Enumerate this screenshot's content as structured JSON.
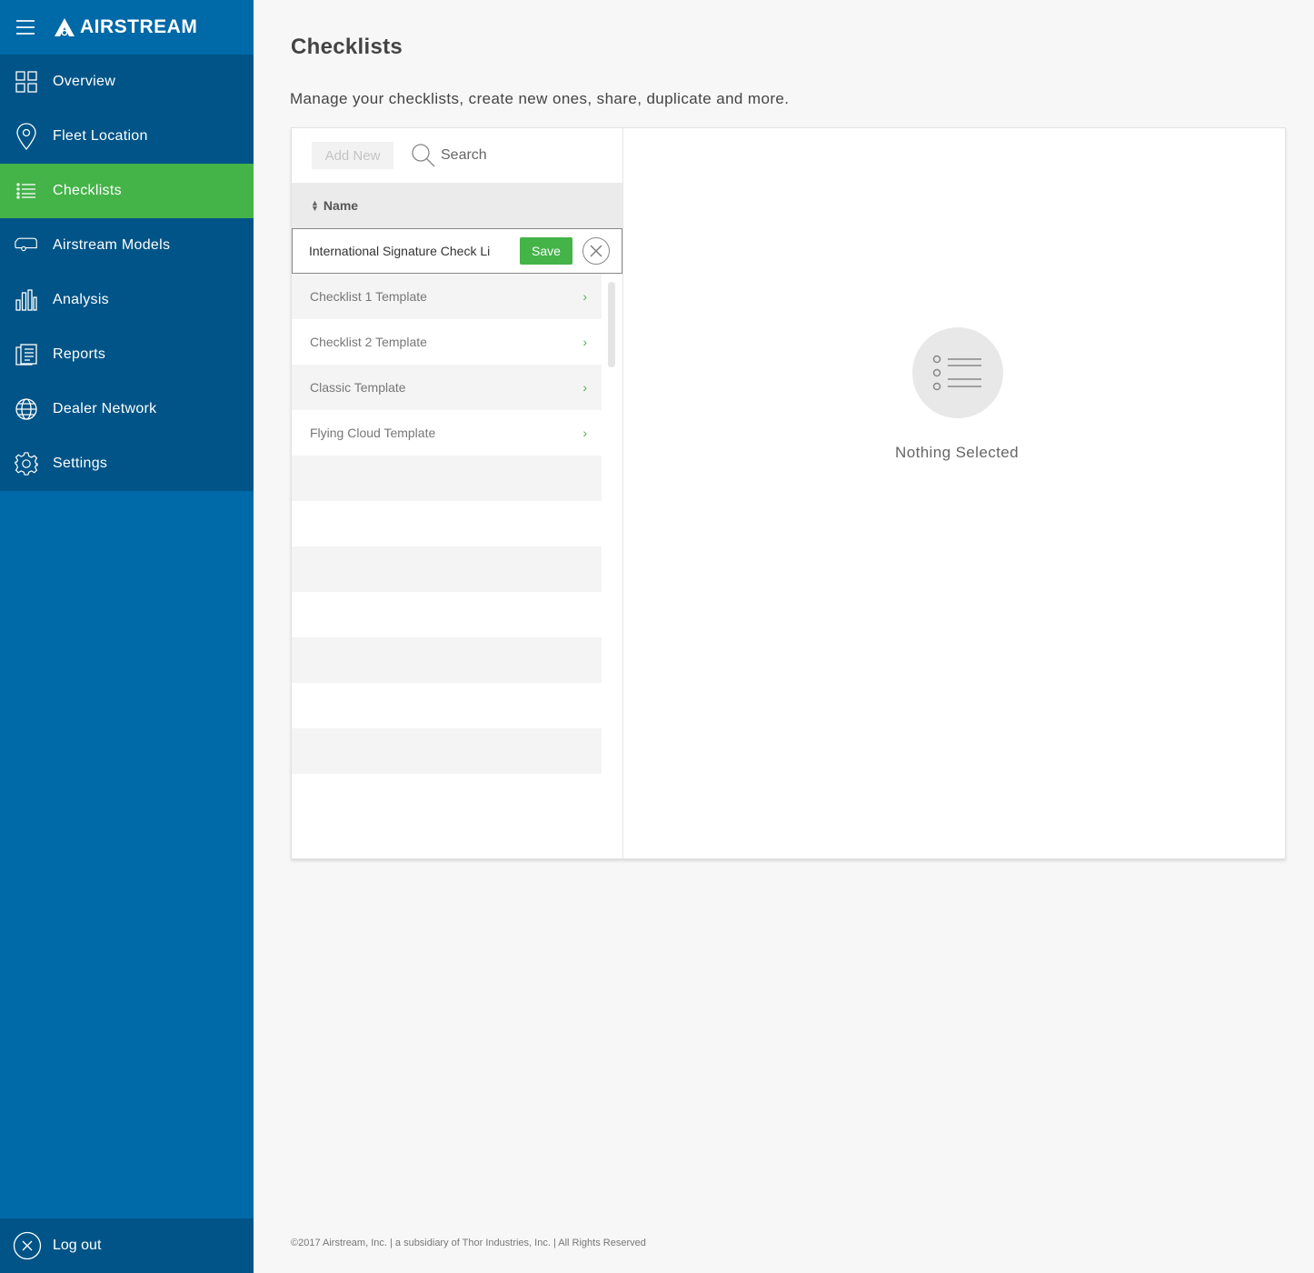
{
  "brand": {
    "name": "AIRSTREAM"
  },
  "sidebar": {
    "items": [
      {
        "label": "Overview"
      },
      {
        "label": "Fleet Location"
      },
      {
        "label": "Checklists"
      },
      {
        "label": "Airstream Models"
      },
      {
        "label": "Analysis"
      },
      {
        "label": "Reports"
      },
      {
        "label": "Dealer Network"
      },
      {
        "label": "Settings"
      }
    ],
    "active": "Checklists",
    "logout_label": "Log out"
  },
  "page": {
    "title": "Checklists",
    "subtitle": "Manage your checklists, create new ones, share, duplicate and more."
  },
  "toolbar": {
    "add_new_label": "Add New",
    "search_placeholder": "Search"
  },
  "table": {
    "column_header": "Name",
    "edit_row": {
      "value": "International Signature Check Li",
      "save_label": "Save"
    },
    "rows": [
      {
        "name": "Checklist 1 Template"
      },
      {
        "name": "Checklist 2 Template"
      },
      {
        "name": "Classic Template"
      },
      {
        "name": "Flying Cloud Template"
      }
    ]
  },
  "detail": {
    "empty_text": "Nothing Selected"
  },
  "footer": {
    "text": "©2017 Airstream, Inc. | a subsidiary of Thor Industries, Inc. | All Rights Reserved"
  },
  "colors": {
    "sidebar_bg": "#0069a8",
    "nav_bg": "#005487",
    "active_green": "#44b348"
  }
}
